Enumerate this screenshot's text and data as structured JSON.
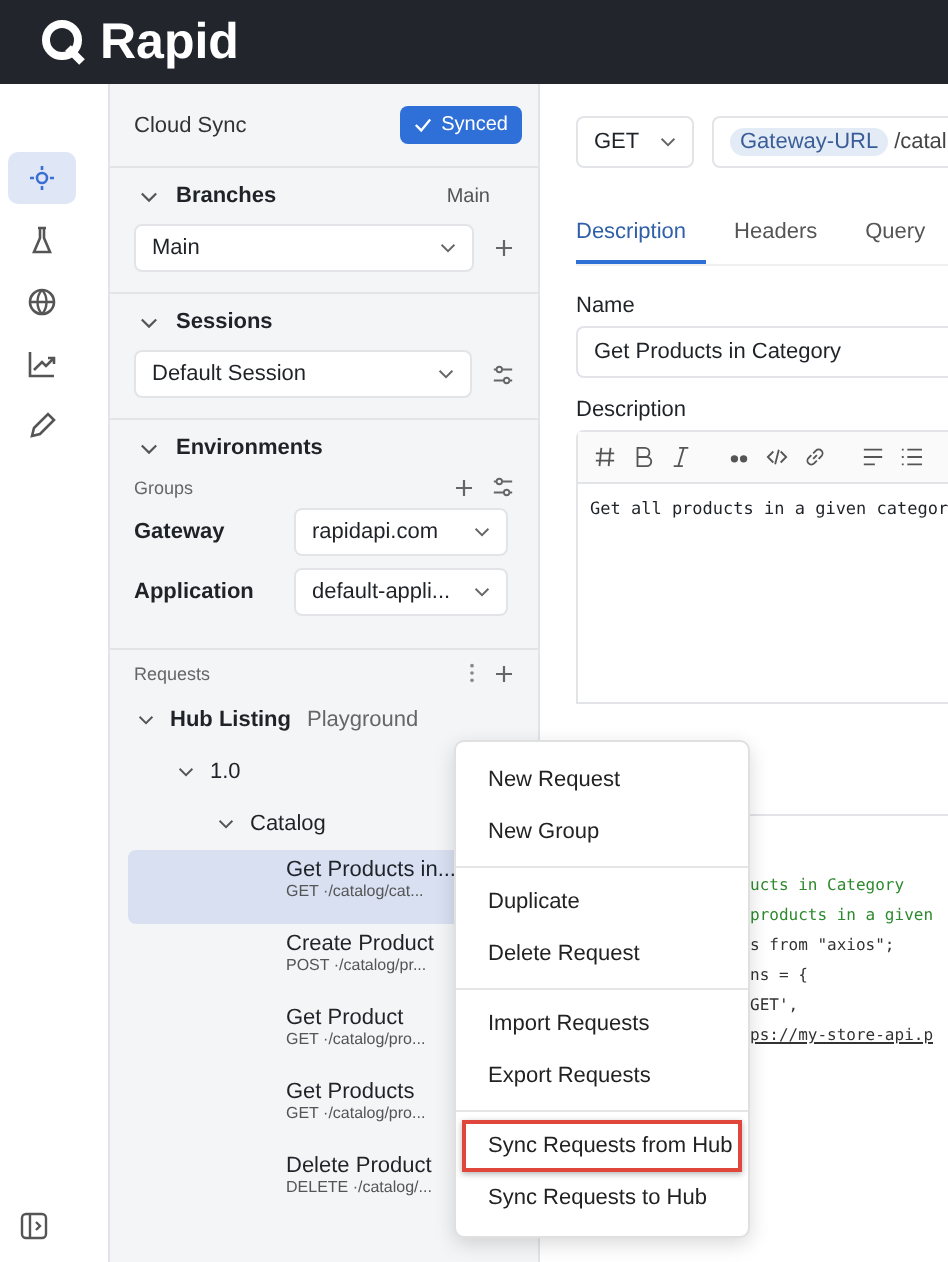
{
  "app": {
    "name": "Rapid"
  },
  "rail": [
    {
      "selected": true
    },
    {
      "selected": false
    },
    {
      "selected": false
    },
    {
      "selected": false
    },
    {
      "selected": false
    }
  ],
  "sidebar": {
    "cloud_sync": {
      "title": "Cloud Sync",
      "status": "Synced"
    },
    "branches": {
      "title": "Branches",
      "current": "Main",
      "value": "Main"
    },
    "sessions": {
      "title": "Sessions",
      "value": "Default Session"
    },
    "environments": {
      "title": "Environments",
      "groups_label": "Groups",
      "rows": [
        {
          "label": "Gateway",
          "value": "rapidapi.com"
        },
        {
          "label": "Application",
          "value": "default-appli..."
        }
      ]
    },
    "requests": {
      "title": "Requests",
      "project": "Hub Listing",
      "project_tag": "Playground",
      "version": "1.0",
      "group": "Catalog",
      "items": [
        {
          "name": "Get Products in...",
          "route": "GET ·/catalog/cat...",
          "selected": true
        },
        {
          "name": "Create Product",
          "route": "POST ·/catalog/pr...",
          "selected": false
        },
        {
          "name": "Get Product",
          "route": "GET ·/catalog/pro...",
          "selected": false
        },
        {
          "name": "Get Products",
          "route": "GET ·/catalog/pro...",
          "selected": false
        },
        {
          "name": "Delete Product",
          "route": "DELETE ·/catalog/...",
          "selected": false
        }
      ]
    }
  },
  "request": {
    "method": "GET",
    "url_variable": "Gateway-URL",
    "url_path": "/catal",
    "tabs": [
      {
        "label": "Description",
        "selected": true
      },
      {
        "label": "Headers",
        "selected": false
      },
      {
        "label": "Query",
        "selected": false
      }
    ],
    "name_label": "Name",
    "name_value": "Get Products in Category",
    "description_label": "Description",
    "description_text": "Get all products in a given categor"
  },
  "code_lines": [
    {
      "text": "ucts in Category",
      "kind": "comment"
    },
    {
      "text": "products in a given",
      "kind": "comment"
    },
    {
      "text": "s from \"axios\";",
      "kind": "plain"
    },
    {
      "text": "ns = {",
      "kind": "plain"
    },
    {
      "text": "GET',",
      "kind": "plain"
    },
    {
      "text": "ps://my-store-api.p",
      "kind": "link"
    }
  ],
  "context_menu": [
    [
      {
        "label": "New Request",
        "highlighted": false
      },
      {
        "label": "New Group",
        "highlighted": false
      }
    ],
    [
      {
        "label": "Duplicate",
        "highlighted": false
      },
      {
        "label": "Delete Request",
        "highlighted": false
      }
    ],
    [
      {
        "label": "Import Requests",
        "highlighted": false
      },
      {
        "label": "Export Requests",
        "highlighted": false
      }
    ],
    [
      {
        "label": "Sync Requests from Hub",
        "highlighted": true
      },
      {
        "label": "Sync Requests to Hub",
        "highlighted": false
      }
    ]
  ]
}
